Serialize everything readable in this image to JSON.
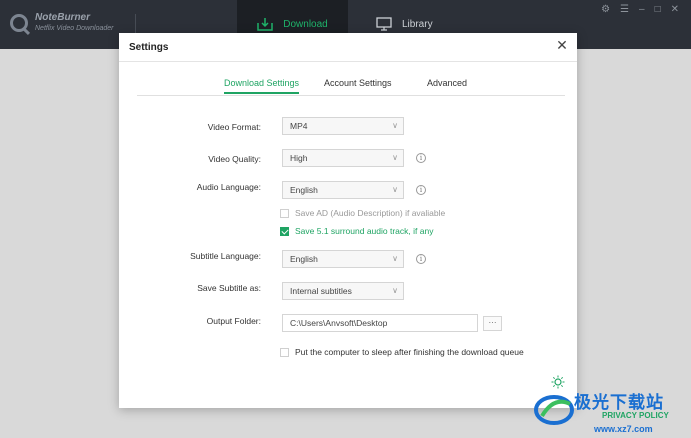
{
  "app": {
    "name": "NoteBurner",
    "subtitle": "Netflix Video Downloader"
  },
  "topbar": {
    "download_label": "Download",
    "library_label": "Library",
    "settings_icon": "gear-icon",
    "menu_icon": "hamburger-icon",
    "minimize_icon": "minimize-icon",
    "maximize_icon": "maximize-icon",
    "close_icon": "close-icon"
  },
  "dialog": {
    "title": "Settings",
    "tabs": [
      "Download Settings",
      "Account Settings",
      "Advanced"
    ],
    "active_tab": "Download Settings",
    "video_format": {
      "label": "Video Format:",
      "value": "MP4"
    },
    "video_quality": {
      "label": "Video Quality:",
      "value": "High"
    },
    "audio_language": {
      "label": "Audio Language:",
      "value": "English"
    },
    "save_ad": {
      "label": "Save AD (Audio Description) if avaliable",
      "checked": false
    },
    "save_51": {
      "label": "Save 5.1 surround audio track, if any",
      "checked": true
    },
    "subtitle_language": {
      "label": "Subtitle Language:",
      "value": "English"
    },
    "save_subtitle_as": {
      "label": "Save Subtitle as:",
      "value": "Internal subtitles"
    },
    "output_folder": {
      "label": "Output Folder:",
      "value": "C:\\Users\\Anvsoft\\Desktop",
      "browse": "···"
    },
    "sleep": {
      "label": "Put the computer to sleep after finishing the download queue",
      "checked": false
    }
  },
  "watermark": {
    "text": "极光下载站",
    "url": "www.xz7.com",
    "privacy": "PRIVACY POLICY"
  },
  "colors": {
    "accent": "#1fa463",
    "topbar": "#2c3038",
    "dialog_bg": "#ffffff"
  }
}
